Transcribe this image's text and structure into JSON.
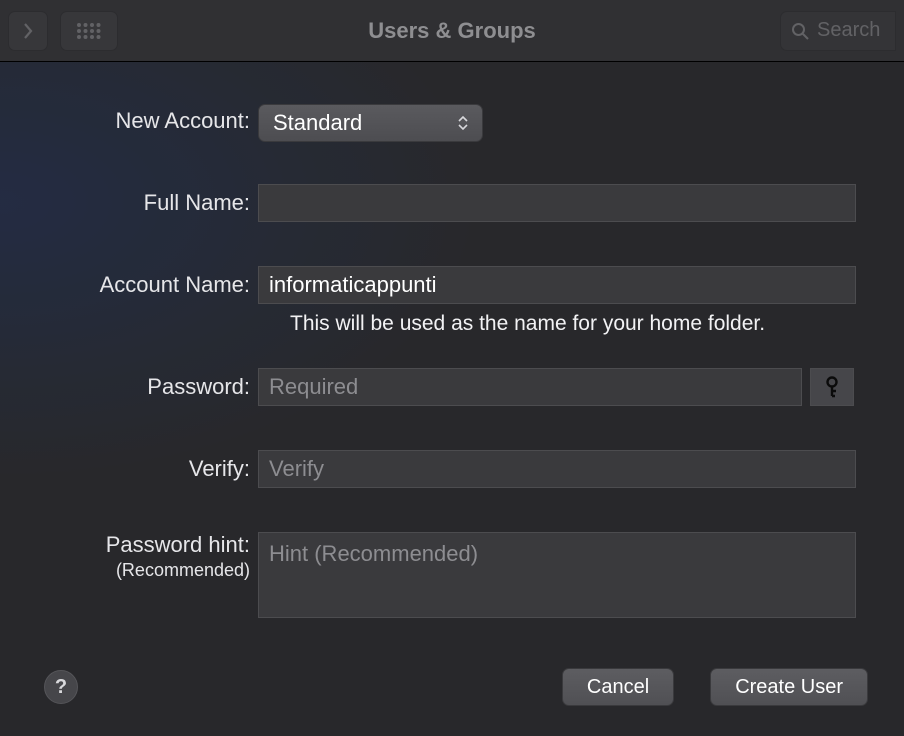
{
  "toolbar": {
    "title": "Users & Groups",
    "search_placeholder": "Search"
  },
  "form": {
    "new_account_label": "New Account:",
    "new_account_value": "Standard",
    "full_name_label": "Full Name:",
    "full_name_value": "",
    "account_name_label": "Account Name:",
    "account_name_value": "informaticappunti",
    "account_name_hint": "This will be used as the name for your home folder.",
    "password_label": "Password:",
    "password_placeholder": "Required",
    "password_value": "",
    "verify_label": "Verify:",
    "verify_placeholder": "Verify",
    "verify_value": "",
    "hint_label": "Password hint:",
    "hint_sub": "(Recommended)",
    "hint_placeholder": "Hint (Recommended)",
    "hint_value": ""
  },
  "footer": {
    "cancel_label": "Cancel",
    "create_label": "Create User"
  }
}
